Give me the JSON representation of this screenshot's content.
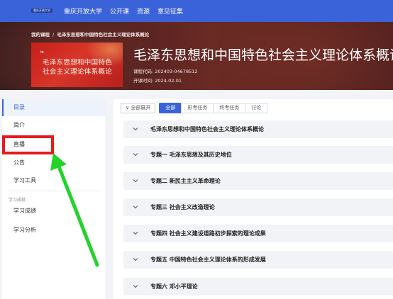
{
  "topnav": {
    "logo_text": "重庆开放大学",
    "items": [
      "重庆开放大学",
      "公开课",
      "资源",
      "意见征集"
    ]
  },
  "banner": {
    "breadcrumb": {
      "root": "我的课程",
      "separator": "/",
      "current": "毛泽东思想和中国特色社会主义理论体系概论"
    },
    "cover": {
      "line1": "毛泽东思想和中国特色",
      "line2": "社会主义理论体系概论"
    },
    "title": "毛泽东思想和中国特色社会主义理论体系概论",
    "course_code": "课程代码: 202403-04678512",
    "start_time": "开课时间: 2024-02-01"
  },
  "sidebar": {
    "items": [
      {
        "label": "目录",
        "active": true
      },
      {
        "label": "简介",
        "active": false
      },
      {
        "label": "直播",
        "active": false
      },
      {
        "label": "公告",
        "active": false
      },
      {
        "label": "学习工具",
        "active": false
      }
    ],
    "group_label": "学习成就",
    "group_items": [
      {
        "label": "学习成绩"
      },
      {
        "label": "学习分析"
      }
    ]
  },
  "filters": {
    "expand_all": "全部展开",
    "tabs": [
      {
        "label": "全部",
        "active": true
      },
      {
        "label": "形考任务",
        "active": false
      },
      {
        "label": "终考任务",
        "active": false
      },
      {
        "label": "讨论",
        "active": false
      }
    ]
  },
  "chapters": [
    "毛泽东思想和中国特色社会主义理论体系概论",
    "专题一 毛泽东思想及其历史地位",
    "专题二 新民主主义革命理论",
    "专题三 社会主义改造理论",
    "专题四 社会主义建设道路初步探索的理论成果",
    "专题五 中国特色社会主义理论体系的形成发展",
    "专题六 邓小平理论"
  ],
  "colors": {
    "accent": "#3b63d9",
    "highlight": "#e5191e",
    "arrow": "#22d32a"
  }
}
